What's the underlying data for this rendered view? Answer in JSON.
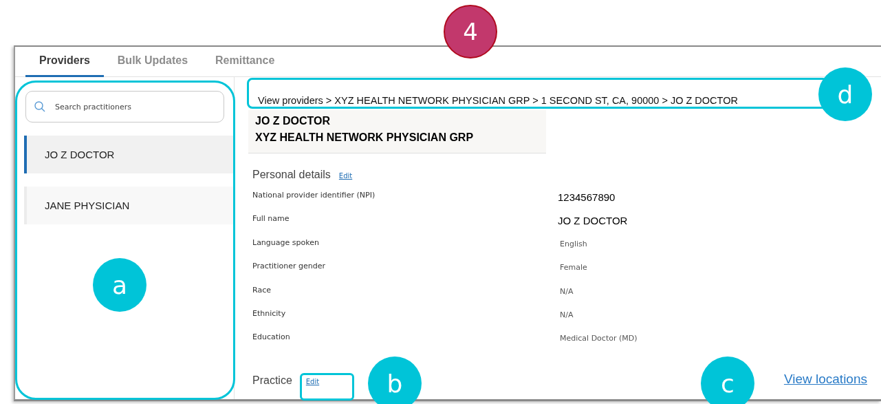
{
  "tabs": [
    {
      "label": "Providers",
      "selected": true
    },
    {
      "label": "Bulk Updates",
      "selected": false
    },
    {
      "label": "Remittance",
      "selected": false
    }
  ],
  "search": {
    "placeholder": "Search practitioners"
  },
  "practitioners": [
    {
      "name": "JO Z DOCTOR",
      "selected": true
    },
    {
      "name": "JANE PHYSICIAN",
      "selected": false
    }
  ],
  "breadcrumb": "View providers > XYZ HEALTH NETWORK PHYSICIAN GRP > 1 SECOND ST, CA, 90000 > JO Z DOCTOR",
  "header": {
    "name": "JO Z DOCTOR",
    "group": "XYZ HEALTH NETWORK PHYSICIAN GRP"
  },
  "personal_details": {
    "title": "Personal details",
    "edit": "Edit",
    "fields": [
      {
        "label": "National provider identifier (NPI)",
        "value": "1234567890",
        "kind": "large"
      },
      {
        "label": "Full name",
        "value": "JO Z DOCTOR",
        "kind": "large"
      },
      {
        "label": "Language spoken",
        "value": "English",
        "kind": "small"
      },
      {
        "label": "Practitioner gender",
        "value": "Female",
        "kind": "small"
      },
      {
        "label": "Race",
        "value": "N/A",
        "kind": "small"
      },
      {
        "label": "Ethnicity",
        "value": "N/A",
        "kind": "small"
      },
      {
        "label": "Education",
        "value": "Medical Doctor (MD)",
        "kind": "small"
      }
    ]
  },
  "practice": {
    "title": "Practice",
    "edit": "Edit"
  },
  "view_locations": "View locations",
  "callouts": [
    {
      "kind": "step",
      "label": "4"
    },
    {
      "kind": "letter",
      "label": "d"
    },
    {
      "kind": "letter",
      "label": "a"
    },
    {
      "kind": "letter",
      "label": "b"
    },
    {
      "kind": "letter",
      "label": "c"
    }
  ]
}
